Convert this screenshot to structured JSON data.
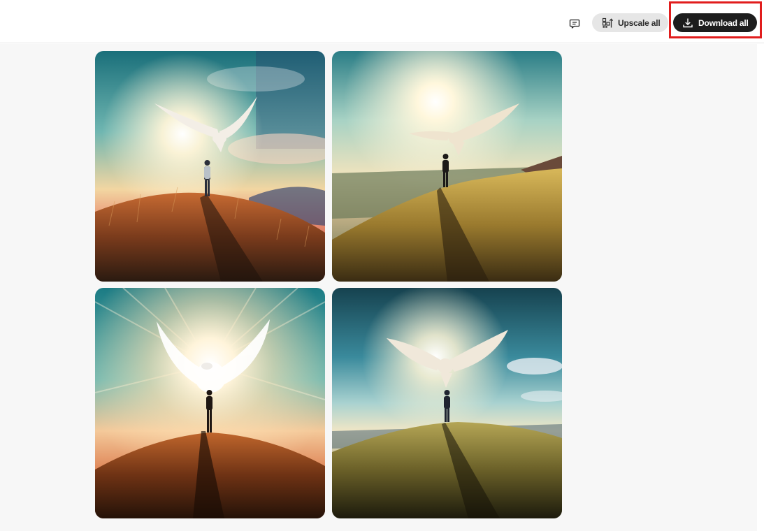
{
  "header": {
    "feedback_icon": "speech-bubble-icon",
    "upscale_all_label": "Upscale all",
    "upscale_icon": "upscale-icon",
    "download_all_label": "Download all",
    "download_icon": "download-icon"
  },
  "colors": {
    "download_button_bg": "#1d1d1d",
    "upscale_button_bg": "#e6e6e6",
    "highlight_border": "#e11d1d",
    "content_bg": "#f7f7f7"
  },
  "gallery": {
    "images": [
      {
        "name": "generated-image-1",
        "description_icon": "bird-over-man-on-hill-image"
      },
      {
        "name": "generated-image-2",
        "description_icon": "bird-over-man-on-hill-image"
      },
      {
        "name": "generated-image-3",
        "description_icon": "bird-over-man-on-hill-image"
      },
      {
        "name": "generated-image-4",
        "description_icon": "bird-over-man-on-hill-image"
      }
    ]
  }
}
